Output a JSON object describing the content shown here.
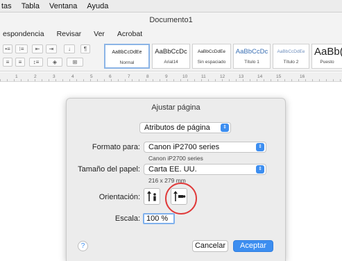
{
  "menubar": {
    "items": [
      "tas",
      "Tabla",
      "Ventana",
      "Ayuda"
    ]
  },
  "window": {
    "title": "Documento1"
  },
  "ribbon": {
    "tabs": [
      "espondencia",
      "Revisar",
      "Ver",
      "Acrobat"
    ],
    "styles": [
      {
        "preview": "AaBbCcDdEe",
        "label": "Normal"
      },
      {
        "preview": "AaBbCcDc",
        "label": "Arial14"
      },
      {
        "preview": "AaBbCcDdEe",
        "label": "Sin espaciado"
      },
      {
        "preview": "AaBbCcDc",
        "label": "Título 1"
      },
      {
        "preview": "AaBbCcDdEe",
        "label": "Título 2"
      },
      {
        "preview": "AaBb(",
        "label": "Puesto"
      }
    ]
  },
  "ruler": {
    "numbers": [
      "1",
      "2",
      "3",
      "4",
      "5",
      "6",
      "7",
      "8",
      "9",
      "10",
      "11",
      "12",
      "13",
      "14",
      "15",
      "16"
    ]
  },
  "dialog": {
    "title": "Ajustar página",
    "attributes_popup": "Atributos de página",
    "format_label": "Formato para:",
    "format_value": "Canon iP2700 series",
    "format_sub": "Canon iP2700 series",
    "paper_label": "Tamaño del papel:",
    "paper_value": "Carta EE. UU.",
    "paper_sub": "216 x 279 mm",
    "orientation_label": "Orientación:",
    "scale_label": "Escala:",
    "scale_value": "100 %",
    "help": "?",
    "cancel": "Cancelar",
    "ok": "Aceptar"
  },
  "colors": {
    "accent": "#3d8ef0",
    "highlight_circle": "#e03a3a"
  }
}
